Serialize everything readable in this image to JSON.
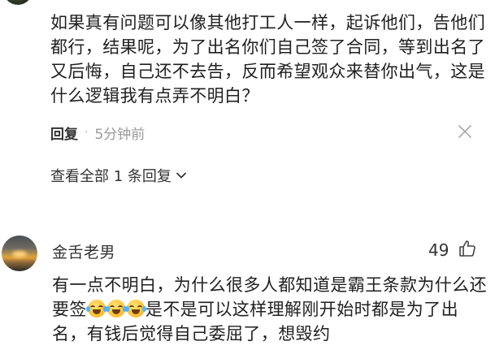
{
  "comment1": {
    "lines": [
      "如果真有问题可以像其他打工人一样，起诉他们，告他们",
      "都行，结果呢，为了出名你们自己签了合同，等到出名了",
      "又后悔，自己还不去告，反而希望观众来替你出气，这是",
      "什么逻辑我有点弄不明白？"
    ],
    "reply_label": "回复",
    "dot": "·",
    "time": "5分钟前"
  },
  "view_all_label": "查看全部 1 条回复",
  "comment2": {
    "username": "金舌老男",
    "likes": "49",
    "line1": "有一点不明白，为什么很多人都知道是霸王条款为什么还",
    "line2_pre": "要签",
    "line2_post": "是不是可以这样理解刚开始时都是为了出",
    "line3": "名，有钱后觉得自己委屈了，想毁约",
    "emojis": [
      "laugh-cry-emoji",
      "laugh-cry-emoji",
      "laugh-cry-emoji"
    ]
  },
  "icons": {
    "dismiss": "close-icon",
    "chevron": "chevron-down-icon",
    "like": "thumbs-up-icon"
  }
}
